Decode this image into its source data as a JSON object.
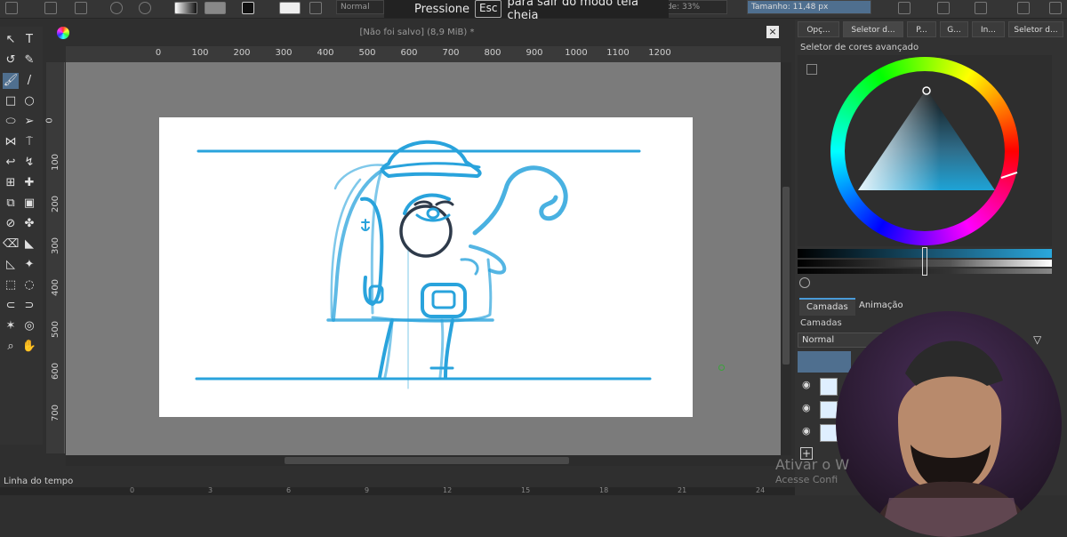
{
  "banner": {
    "prefix": "Pressione",
    "key": "Esc",
    "suffix": "para sair do modo tela cheia"
  },
  "toolbar": {
    "blend_mode": "Normal",
    "opacity_label": "...idade: 33%",
    "size_label": "Tamanho: 11,48 px"
  },
  "document": {
    "title": "[Não foi salvo]  (8,9 MiB) *",
    "close": "×"
  },
  "ruler_h": [
    "0",
    "100",
    "200",
    "300",
    "400",
    "500",
    "600",
    "700",
    "800",
    "900",
    "1000",
    "1100",
    "1200"
  ],
  "ruler_v": [
    "0",
    "100",
    "200",
    "300",
    "400",
    "500",
    "600",
    "700"
  ],
  "tools": [
    "↖",
    "T",
    "↺",
    "✎",
    "🖌",
    "/",
    "□",
    "○",
    "⬭",
    "➢",
    "⋈",
    "⍑",
    "↩",
    "↯",
    "⊞",
    "✚",
    "⧉",
    "▣",
    "⊘",
    "✤",
    "⌫",
    "◣",
    "◺",
    "✦",
    "⬚",
    "◌",
    "⊂",
    "⊃",
    "✶",
    "◎",
    "⌕",
    "✋"
  ],
  "panel": {
    "tabs": [
      "Opç...",
      "Seletor d...",
      "P...",
      "G...",
      "In...",
      "Seletor d..."
    ],
    "color_selector_title": "Seletor de cores avançado",
    "layers_tabs": [
      "Camadas",
      "Animação"
    ],
    "layers_heading": "Camadas",
    "layers_blend": "Normal"
  },
  "timeline": {
    "label": "Linha do tempo",
    "ticks": [
      "0",
      "3",
      "6",
      "9",
      "12",
      "15",
      "18",
      "21",
      "24"
    ]
  },
  "watermark": {
    "line1": "Ativar o W",
    "line2": "Acesse Confi"
  },
  "colors": {
    "stroke": "#29a3dc",
    "accent": "#4a9bd8",
    "canvas_bg": "#7b7b7b"
  }
}
